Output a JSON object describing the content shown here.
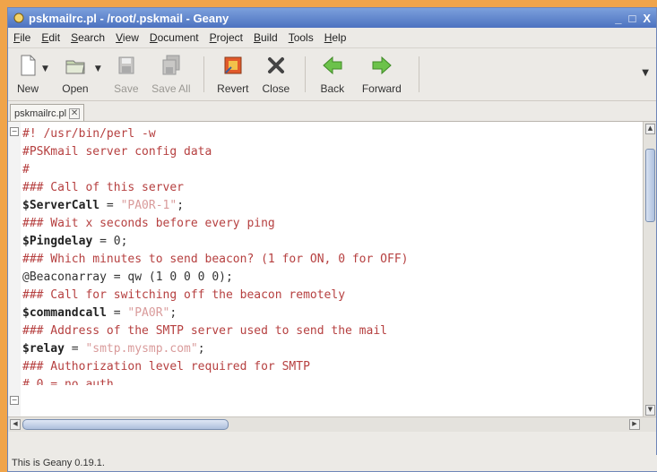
{
  "window": {
    "title": "pskmailrc.pl - /root/.pskmail - Geany",
    "minimize_glyph": "_",
    "maximize_glyph": "□",
    "close_glyph": "X"
  },
  "menu": [
    "File",
    "Edit",
    "Search",
    "View",
    "Document",
    "Project",
    "Build",
    "Tools",
    "Help"
  ],
  "toolbar": {
    "new_label": "New",
    "open_label": "Open",
    "save_label": "Save",
    "save_all_label": "Save All",
    "revert_label": "Revert",
    "close_label": "Close",
    "back_label": "Back",
    "forward_label": "Forward"
  },
  "tab": {
    "label": "pskmailrc.pl"
  },
  "code": {
    "l1": "#! /usr/bin/perl -w",
    "l2": "#PSKmail server config data",
    "l3": "#",
    "l4": "### Call of this server",
    "l5_var": "$ServerCall",
    "l5_op": " = ",
    "l5_str": "\"PA0R-1\"",
    "l5_end": ";",
    "l6": "### Wait x seconds before every ping",
    "l7_var": "$Pingdelay",
    "l7_op": " = 0;",
    "l8": "### Which minutes to send beacon? (1 for ON, 0 for OFF)",
    "l9": "@Beaconarray = qw (1 0 0 0 0);",
    "l10": "### Call for switching off the beacon remotely",
    "l11_var": "$commandcall",
    "l11_op": " = ",
    "l11_str": "\"PA0R\"",
    "l11_end": ";",
    "l12": "### Address of the SMTP server used to send the mail",
    "l13_var": "$relay",
    "l13_op": " = ",
    "l13_str": "\"smtp.mysmp.com\"",
    "l13_end": ";",
    "l14": "### Authorization level required for SMTP",
    "l15": "# 0 = no auth"
  },
  "status": {
    "text": "This is Geany 0.19.1."
  },
  "colors": {
    "comment": "#b64040",
    "string": "#d99b9b",
    "titlebar": "#4d72c0",
    "background": "#f0a44a"
  }
}
